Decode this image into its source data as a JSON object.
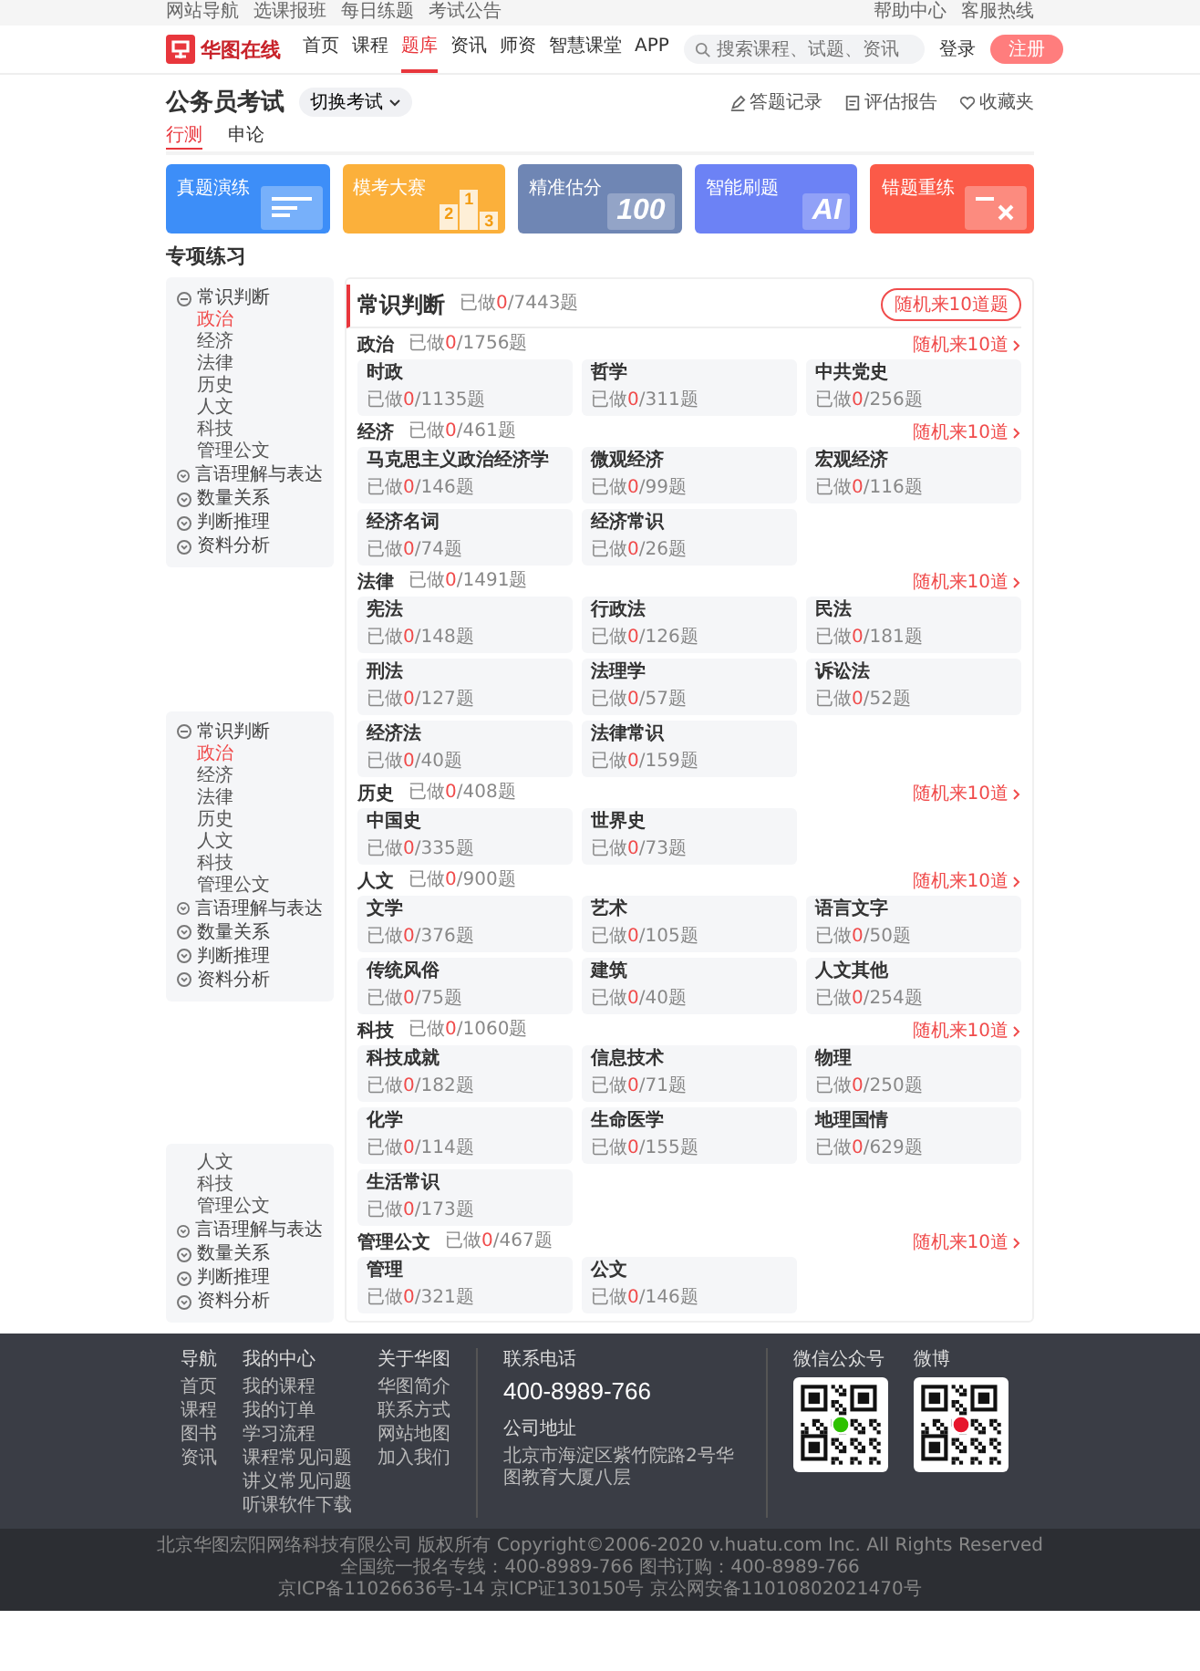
{
  "top_bar": {
    "left_links": [
      "网站导航",
      "选课报班",
      "每日练题",
      "考试公告"
    ],
    "right_links": [
      "帮助中心",
      "客服热线"
    ]
  },
  "nav": {
    "logo": "华图在线",
    "items": [
      {
        "label": "首页",
        "selected": false
      },
      {
        "label": "课程",
        "selected": false
      },
      {
        "label": "题库",
        "selected": true
      },
      {
        "label": "资讯",
        "selected": false
      },
      {
        "label": "师资",
        "selected": false
      },
      {
        "label": "智慧课堂",
        "selected": false
      },
      {
        "label": "APP",
        "selected": false
      }
    ],
    "search": {
      "placeholder": "搜索课程、试题、资讯"
    },
    "login": "登录",
    "register": "注册"
  },
  "page_header": {
    "title": "公务员考试",
    "switch": "切换考试",
    "actions": [
      {
        "kind": "pencil",
        "label": "答题记录"
      },
      {
        "kind": "report",
        "label": "评估报告"
      },
      {
        "kind": "heart",
        "label": "收藏夹"
      }
    ]
  },
  "tabs": [
    {
      "label": "行测",
      "selected": true
    },
    {
      "label": "申论",
      "selected": false
    }
  ],
  "banners": [
    {
      "label": "真题演练",
      "color": "#3d8ef8",
      "kind": "lines"
    },
    {
      "label": "模考大赛",
      "color": "#fbb03b",
      "kind": "podium",
      "marks": [
        "2",
        "1",
        "3"
      ]
    },
    {
      "label": "精准估分",
      "color": "#6f86b4",
      "kind": "score",
      "marks": [
        "100"
      ]
    },
    {
      "label": "智能刷题",
      "color": "#6c82f5",
      "kind": "ai",
      "marks": [
        "AI"
      ]
    },
    {
      "label": "错题重练",
      "color": "#fb5a48",
      "kind": "cross"
    }
  ],
  "practice_title": "专项练习",
  "sidebar_panels": [
    {
      "groups": [
        {
          "label": "常识判断",
          "expanded": true,
          "children": [
            {
              "label": "政治",
              "selected": true
            },
            {
              "label": "经济",
              "selected": false
            },
            {
              "label": "法律",
              "selected": false
            },
            {
              "label": "历史",
              "selected": false
            },
            {
              "label": "人文",
              "selected": false
            },
            {
              "label": "科技",
              "selected": false
            },
            {
              "label": "管理公文",
              "selected": false
            }
          ]
        },
        {
          "label": "言语理解与表达",
          "expanded": false
        },
        {
          "label": "数量关系",
          "expanded": false
        },
        {
          "label": "判断推理",
          "expanded": false
        },
        {
          "label": "资料分析",
          "expanded": false
        }
      ]
    },
    {
      "groups": [
        {
          "label": "常识判断",
          "expanded": true,
          "children": [
            {
              "label": "政治",
              "selected": true
            },
            {
              "label": "经济",
              "selected": false
            },
            {
              "label": "法律",
              "selected": false
            },
            {
              "label": "历史",
              "selected": false
            },
            {
              "label": "人文",
              "selected": false
            },
            {
              "label": "科技",
              "selected": false
            },
            {
              "label": "管理公文",
              "selected": false
            }
          ]
        },
        {
          "label": "言语理解与表达",
          "expanded": false
        },
        {
          "label": "数量关系",
          "expanded": false
        },
        {
          "label": "判断推理",
          "expanded": false
        },
        {
          "label": "资料分析",
          "expanded": false
        }
      ]
    },
    {
      "groups": [
        {
          "children": [
            {
              "label": "人文",
              "selected": false
            },
            {
              "label": "科技",
              "selected": false
            },
            {
              "label": "管理公文",
              "selected": false
            }
          ]
        },
        {
          "label": "言语理解与表达",
          "expanded": false
        },
        {
          "label": "数量关系",
          "expanded": false
        },
        {
          "label": "判断推理",
          "expanded": false
        },
        {
          "label": "资料分析",
          "expanded": false
        }
      ]
    }
  ],
  "main": {
    "title": "常识判断",
    "progress": [
      "已做",
      "0",
      "/7443题"
    ],
    "random_button": "随机来10道题",
    "sections": [
      {
        "title": "政治",
        "progress": [
          "已做",
          "0",
          "/1756题"
        ],
        "link": "随机来10道",
        "cards": [
          {
            "title": "时政",
            "progress": [
              "已做",
              "0",
              "/1135题"
            ]
          },
          {
            "title": "哲学",
            "progress": [
              "已做",
              "0",
              "/311题"
            ]
          },
          {
            "title": "中共党史",
            "progress": [
              "已做",
              "0",
              "/256题"
            ]
          }
        ]
      },
      {
        "title": "经济",
        "progress": [
          "已做",
          "0",
          "/461题"
        ],
        "link": "随机来10道",
        "cards": [
          {
            "title": "马克思主义政治经济学",
            "progress": [
              "已做",
              "0",
              "/146题"
            ]
          },
          {
            "title": "微观经济",
            "progress": [
              "已做",
              "0",
              "/99题"
            ]
          },
          {
            "title": "宏观经济",
            "progress": [
              "已做",
              "0",
              "/116题"
            ]
          },
          {
            "title": "经济名词",
            "progress": [
              "已做",
              "0",
              "/74题"
            ]
          },
          {
            "title": "经济常识",
            "progress": [
              "已做",
              "0",
              "/26题"
            ]
          }
        ]
      },
      {
        "title": "法律",
        "progress": [
          "已做",
          "0",
          "/1491题"
        ],
        "link": "随机来10道",
        "cards": [
          {
            "title": "宪法",
            "progress": [
              "已做",
              "0",
              "/148题"
            ]
          },
          {
            "title": "行政法",
            "progress": [
              "已做",
              "0",
              "/126题"
            ]
          },
          {
            "title": "民法",
            "progress": [
              "已做",
              "0",
              "/181题"
            ]
          },
          {
            "title": "刑法",
            "progress": [
              "已做",
              "0",
              "/127题"
            ]
          },
          {
            "title": "法理学",
            "progress": [
              "已做",
              "0",
              "/57题"
            ]
          },
          {
            "title": "诉讼法",
            "progress": [
              "已做",
              "0",
              "/52题"
            ]
          },
          {
            "title": "经济法",
            "progress": [
              "已做",
              "0",
              "/40题"
            ]
          },
          {
            "title": "法律常识",
            "progress": [
              "已做",
              "0",
              "/159题"
            ]
          }
        ]
      },
      {
        "title": "历史",
        "progress": [
          "已做",
          "0",
          "/408题"
        ],
        "link": "随机来10道",
        "cards": [
          {
            "title": "中国史",
            "progress": [
              "已做",
              "0",
              "/335题"
            ]
          },
          {
            "title": "世界史",
            "progress": [
              "已做",
              "0",
              "/73题"
            ]
          }
        ]
      },
      {
        "title": "人文",
        "progress": [
          "已做",
          "0",
          "/900题"
        ],
        "link": "随机来10道",
        "cards": [
          {
            "title": "文学",
            "progress": [
              "已做",
              "0",
              "/376题"
            ]
          },
          {
            "title": "艺术",
            "progress": [
              "已做",
              "0",
              "/105题"
            ]
          },
          {
            "title": "语言文字",
            "progress": [
              "已做",
              "0",
              "/50题"
            ]
          },
          {
            "title": "传统风俗",
            "progress": [
              "已做",
              "0",
              "/75题"
            ]
          },
          {
            "title": "建筑",
            "progress": [
              "已做",
              "0",
              "/40题"
            ]
          },
          {
            "title": "人文其他",
            "progress": [
              "已做",
              "0",
              "/254题"
            ]
          }
        ]
      },
      {
        "title": "科技",
        "progress": [
          "已做",
          "0",
          "/1060题"
        ],
        "link": "随机来10道",
        "cards": [
          {
            "title": "科技成就",
            "progress": [
              "已做",
              "0",
              "/182题"
            ]
          },
          {
            "title": "信息技术",
            "progress": [
              "已做",
              "0",
              "/71题"
            ]
          },
          {
            "title": "物理",
            "progress": [
              "已做",
              "0",
              "/250题"
            ]
          },
          {
            "title": "化学",
            "progress": [
              "已做",
              "0",
              "/114题"
            ]
          },
          {
            "title": "生命医学",
            "progress": [
              "已做",
              "0",
              "/155题"
            ]
          },
          {
            "title": "地理国情",
            "progress": [
              "已做",
              "0",
              "/629题"
            ]
          },
          {
            "title": "生活常识",
            "progress": [
              "已做",
              "0",
              "/173题"
            ]
          }
        ]
      },
      {
        "title": "管理公文",
        "progress": [
          "已做",
          "0",
          "/467题"
        ],
        "link": "随机来10道",
        "cards": [
          {
            "title": "管理",
            "progress": [
              "已做",
              "0",
              "/321题"
            ]
          },
          {
            "title": "公文",
            "progress": [
              "已做",
              "0",
              "/146题"
            ]
          }
        ]
      }
    ]
  },
  "footer": {
    "columns": [
      {
        "title": "导航",
        "links": [
          "首页",
          "课程",
          "图书",
          "资讯"
        ]
      },
      {
        "title": "我的中心",
        "links": [
          "我的课程",
          "我的订单",
          "学习流程",
          "课程常见问题",
          "讲义常见问题",
          "听课软件下载"
        ]
      },
      {
        "title": "关于华图",
        "links": [
          "华图简介",
          "联系方式",
          "网站地图",
          "加入我们"
        ]
      }
    ],
    "phone_title": "联系电话",
    "phone": "400-8989-766",
    "address_title": "公司地址",
    "address": "北京市海淀区紫竹院路2号华图教育大厦八层",
    "qr_codes": [
      {
        "title": "微信公众号",
        "kind": "wechat"
      },
      {
        "title": "微博",
        "kind": "weibo"
      }
    ],
    "legal": [
      "北京华图宏阳网络科技有限公司 版权所有 Copyright©2006-2020 v.huatu.com Inc. All Rights Reserved",
      "全国统一报名专线：400-8989-766 图书订购：400-8989-766",
      "京ICP备11026636号-14 京ICP证130150号 京公网安备11010802021470号"
    ]
  }
}
